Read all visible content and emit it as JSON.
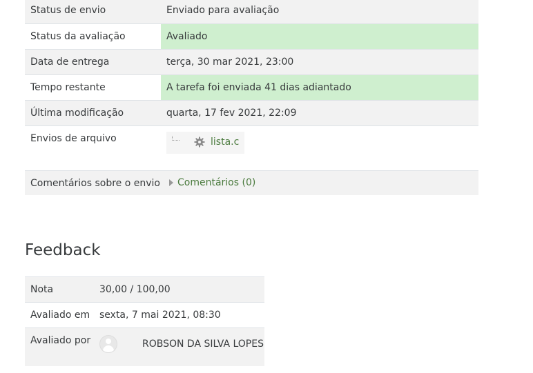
{
  "submission_status": {
    "rows": [
      {
        "label": "Status de envio",
        "value": "Enviado para avaliação"
      },
      {
        "label": "Status da avaliação",
        "value": "Avaliado"
      },
      {
        "label": "Data de entrega",
        "value": "terça, 30 mar 2021, 23:00"
      },
      {
        "label": "Tempo restante",
        "value": "A tarefa foi enviada 41 dias adiantado"
      },
      {
        "label": "Última modificação",
        "value": "quarta, 17 fev 2021, 22:09"
      },
      {
        "label": "Envios de arquivo",
        "file_name": "lista.c",
        "file_icon": "gear-icon"
      },
      {
        "label": "Comentários sobre o envio",
        "link": "Comentários (0)"
      }
    ],
    "success_color": "#cfefcf"
  },
  "feedback": {
    "title": "Feedback",
    "rows": [
      {
        "label": "Nota",
        "value": "30,00 / 100,00"
      },
      {
        "label": "Avaliado em",
        "value": "sexta, 7 mai 2021, 08:30"
      },
      {
        "label": "Avaliado por",
        "value": "ROBSON DA SILVA LOPES",
        "avatar_icon": "user-avatar-icon"
      }
    ]
  },
  "link_color": "#4a7a3d"
}
